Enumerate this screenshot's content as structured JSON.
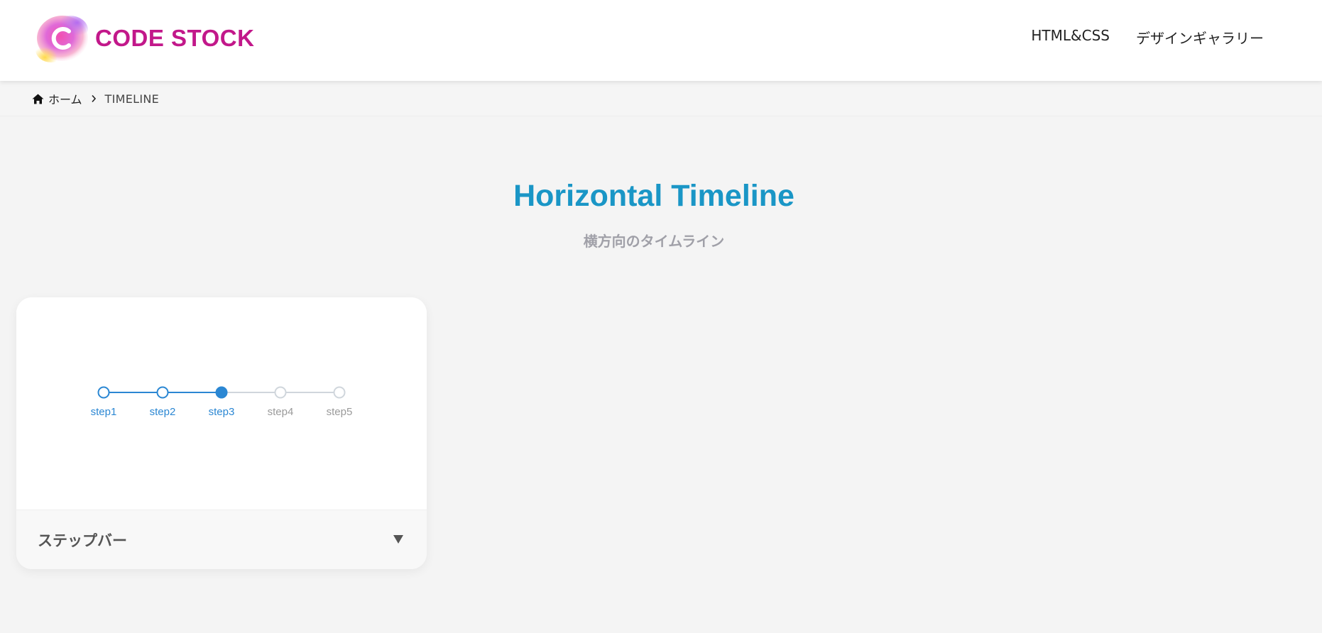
{
  "header": {
    "logo_text": "CODE STOCK",
    "nav": [
      {
        "label": "HTML&CSS"
      },
      {
        "label": "デザインギャラリー"
      }
    ]
  },
  "breadcrumb": {
    "home_label": "ホーム",
    "current": "TIMELINE"
  },
  "main": {
    "title": "Horizontal Timeline",
    "subtitle": "横方向のタイムライン"
  },
  "card": {
    "title": "ステップバー",
    "steps": [
      {
        "label": "step1",
        "state": "done"
      },
      {
        "label": "step2",
        "state": "done"
      },
      {
        "label": "step3",
        "state": "current"
      },
      {
        "label": "step4",
        "state": "todo"
      },
      {
        "label": "step5",
        "state": "todo"
      }
    ]
  },
  "colors": {
    "brand": "#c2188a",
    "title": "#1a96c6",
    "step_active": "#2b87d3",
    "step_inactive": "#d0d6dc",
    "step_label_inactive": "#9a9a9a"
  }
}
